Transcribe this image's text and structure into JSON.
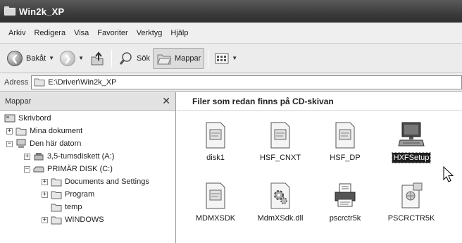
{
  "window": {
    "title": "Win2k_XP"
  },
  "menu": {
    "items": [
      "Arkiv",
      "Redigera",
      "Visa",
      "Favoriter",
      "Verktyg",
      "Hjälp"
    ]
  },
  "toolbar": {
    "back_label": "Bakåt",
    "search_label": "Sök",
    "folders_label": "Mappar"
  },
  "address": {
    "label": "Adress",
    "value": "E:\\Driver\\Win2k_XP"
  },
  "folders_pane": {
    "title": "Mappar",
    "tree": [
      {
        "label": "Skrivbord",
        "icon": "desktop-icon"
      },
      {
        "label": "Mina dokument",
        "icon": "folder-icon",
        "expander": "+"
      },
      {
        "label": "Den här datorn",
        "icon": "computer-icon",
        "expander": "−"
      },
      {
        "label": "3,5-tumsdiskett (A:)",
        "icon": "floppy-icon",
        "expander": "+"
      },
      {
        "label": "PRIMÄR DISK (C:)",
        "icon": "drive-icon",
        "expander": "−"
      },
      {
        "label": "Documents and Settings",
        "icon": "folder-icon",
        "expander": "+"
      },
      {
        "label": "Program",
        "icon": "folder-icon",
        "expander": "+"
      },
      {
        "label": "temp",
        "icon": "folder-icon"
      },
      {
        "label": "WINDOWS",
        "icon": "folder-icon",
        "expander": "+"
      }
    ]
  },
  "main": {
    "group_header": "Filer som redan finns på CD-skivan",
    "files": [
      {
        "name": "disk1",
        "icon": "inf-file-icon"
      },
      {
        "name": "HSF_CNXT",
        "icon": "inf-file-icon"
      },
      {
        "name": "HSF_DP",
        "icon": "inf-file-icon"
      },
      {
        "name": "HXFSetup",
        "icon": "setup-computer-icon",
        "selected": true
      },
      {
        "name": "MDMXSDK",
        "icon": "inf-file-icon"
      },
      {
        "name": "MdmXSdk.dll",
        "icon": "dll-gear-icon"
      },
      {
        "name": "pscrctr5k",
        "icon": "printer-icon"
      },
      {
        "name": "PSCRCTR5K",
        "icon": "catalog-file-icon"
      }
    ]
  }
}
